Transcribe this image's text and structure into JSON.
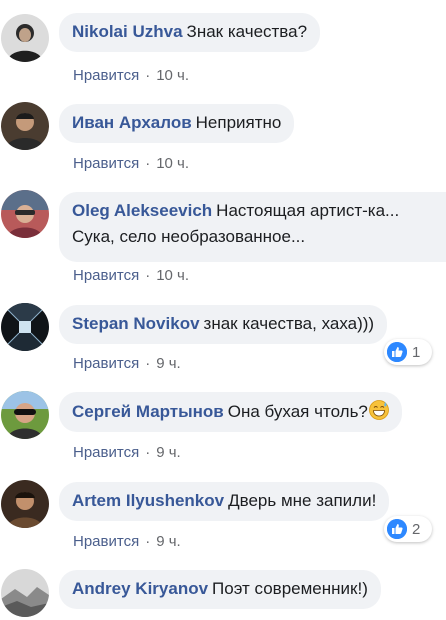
{
  "comments": [
    {
      "author": "Nikolai Uzhva",
      "text": "Знак качества?",
      "like": "Нравится",
      "sep": "·",
      "time": "10 ч.",
      "avatar_icon": "person-avatar-icon"
    },
    {
      "author": "Иван Архалов",
      "text": "Неприятно",
      "like": "Нравится",
      "sep": "·",
      "time": "10 ч.",
      "avatar_icon": "person-avatar-icon"
    },
    {
      "author": "Oleg Alekseevich",
      "text": "Настоящая артист-ка...",
      "text2": "Сука, село необразованное...",
      "like": "Нравится",
      "sep": "·",
      "time": "10 ч.",
      "avatar_icon": "person-avatar-icon"
    },
    {
      "author": "Stepan Novikov",
      "text": "знак качества, хаха)))",
      "like": "Нравится",
      "sep": "·",
      "time": "9 ч.",
      "reactions": "1",
      "avatar_icon": "tunnel-avatar-icon"
    },
    {
      "author": "Сергей Мартынов",
      "text": "Она бухая чтоль?",
      "emoji_icon": "grinning-sweat-emoji-icon",
      "like": "Нравится",
      "sep": "·",
      "time": "9 ч.",
      "avatar_icon": "person-avatar-icon"
    },
    {
      "author": "Artem Ilyushenkov",
      "text": "Дверь мне запили!",
      "like": "Нравится",
      "sep": "·",
      "time": "9 ч.",
      "reactions": "2",
      "avatar_icon": "person-avatar-icon"
    },
    {
      "author": "Andrey Kiryanov",
      "text": "Поэт современник!)",
      "avatar_icon": "landscape-avatar-icon"
    }
  ],
  "colors": {
    "author": "#385898",
    "bubble": "#f0f2f5",
    "like_blue": "#2d88ff",
    "meta": "#65676b"
  }
}
